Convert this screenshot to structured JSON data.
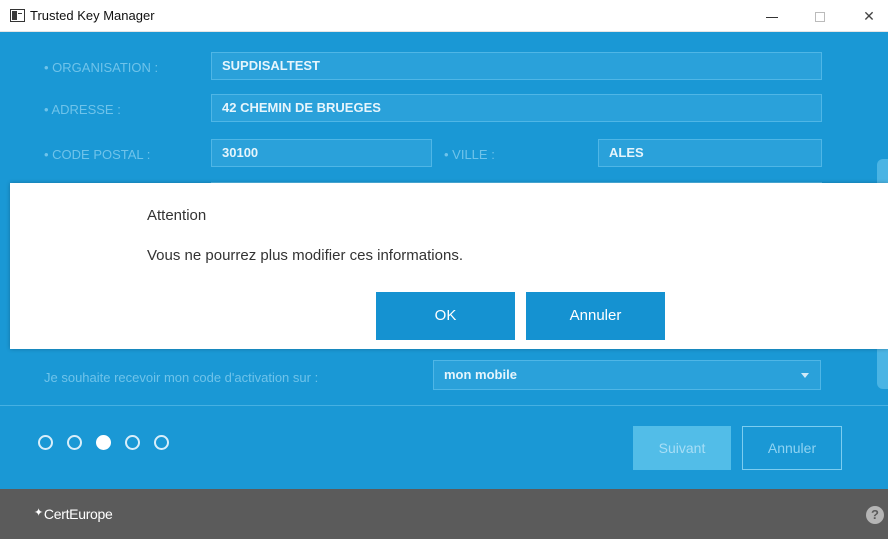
{
  "window": {
    "title": "Trusted Key Manager",
    "controls": {
      "minimize": "minimize-icon",
      "maximize": "maximize-icon",
      "close": "✕"
    }
  },
  "form": {
    "organisation": {
      "label": "• ORGANISATION :",
      "value": "SUPDISALTEST"
    },
    "adresse": {
      "label": "• ADRESSE :",
      "value": "42 CHEMIN DE BRUEGES"
    },
    "code_postal": {
      "label": "• CODE POSTAL :",
      "value": "30100"
    },
    "ville": {
      "label": "• VILLE :",
      "value": "ALES"
    },
    "activation": {
      "label": "Je souhaite recevoir mon code d'activation sur :",
      "selected": "mon mobile"
    }
  },
  "stepper": {
    "total_steps": 5,
    "current_step": 3
  },
  "nav": {
    "next": "Suivant",
    "cancel": "Annuler"
  },
  "dialog": {
    "title": "Attention",
    "message": "Vous ne pourrez plus modifier ces informations.",
    "ok": "OK",
    "cancel": "Annuler"
  },
  "footer": {
    "logo": "CertEurope",
    "logo_mark": "star-icon",
    "help": "?"
  },
  "colors": {
    "accent": "#1a98d5",
    "button": "#1592d1",
    "footer": "#5b5b5b"
  }
}
